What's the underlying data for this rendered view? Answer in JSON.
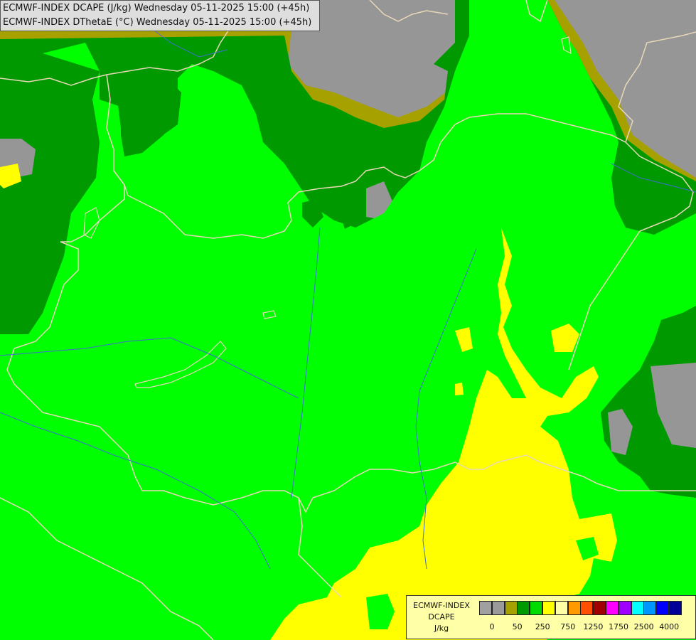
{
  "header": {
    "line1": "ECMWF-INDEX DCAPE (J/kg) Wednesday 05-11-2025 15:00 (+45h)",
    "line2": "ECMWF-INDEX DThetaE (°C) Wednesday 05-11-2025 15:00 (+45h)"
  },
  "legend": {
    "title1": "ECMWF-INDEX",
    "title2": "DCAPE",
    "unit": "J/kg",
    "colors": [
      "#a0a0a0",
      "#9a9a9a",
      "#a7a100",
      "#009a00",
      "#00dc00",
      "#ffff00",
      "#ffffa8",
      "#ff9a00",
      "#ff5000",
      "#a00000",
      "#ff00ff",
      "#a000ff",
      "#00ffff",
      "#0096ff",
      "#0000ff",
      "#000096"
    ],
    "ticks": [
      "0",
      "50",
      "250",
      "750",
      "1250",
      "1750",
      "2500",
      "4000"
    ]
  },
  "colors": {
    "gray": "#969696",
    "olive": "#a7a100",
    "dark_green": "#009a00",
    "light_green": "#00ff00",
    "yellow": "#ffff00",
    "border": "#e8d8b8",
    "river": "#3f6fd0"
  }
}
